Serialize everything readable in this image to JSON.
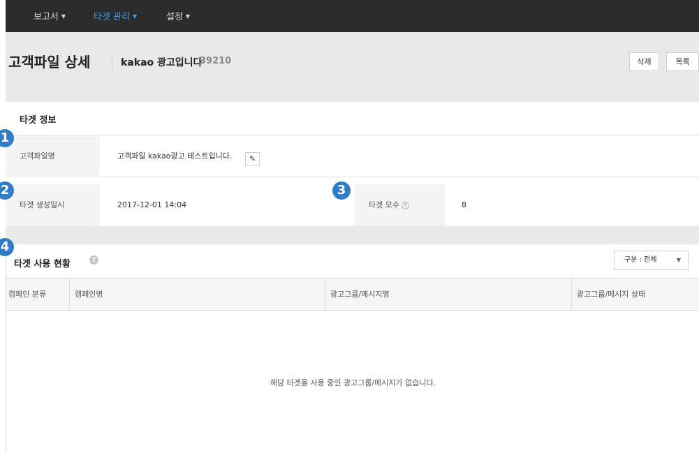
{
  "nav": {
    "items": [
      {
        "label": "보고서"
      },
      {
        "label": "타겟 관리"
      },
      {
        "label": "설정"
      }
    ]
  },
  "header": {
    "title": "고객파일 상세",
    "subtitle": "kakao 광고입니다",
    "id": "39210",
    "delete_label": "삭제",
    "list_label": "목록"
  },
  "target_info": {
    "title": "타겟 정보",
    "file_name_label": "고객파일명",
    "file_name_value": "고객파일 kakao광고 테스트입니다.",
    "created_label": "타겟 생성일시",
    "created_value": "2017-12-01 14:04",
    "population_label": "타겟 모수",
    "population_help": "?",
    "population_value": "8"
  },
  "usage": {
    "title": "타겟 사용 현황",
    "help": "?",
    "filter_value": "구분 : 전체",
    "columns": [
      "캠페인 분류",
      "캠페인명",
      "광고그룹/메시지명",
      "광고그룹/메시지 상태"
    ],
    "empty_message": "해당 타겟을 사용 중인 광고그룹/메시지가 없습니다."
  },
  "annotations": [
    "1",
    "2",
    "3",
    "4"
  ],
  "colors": {
    "nav_bg": "#2b2b2b",
    "nav_active": "#3fa1f0",
    "badge": "#2f7cc7",
    "band_bg": "#e9e9e9"
  }
}
